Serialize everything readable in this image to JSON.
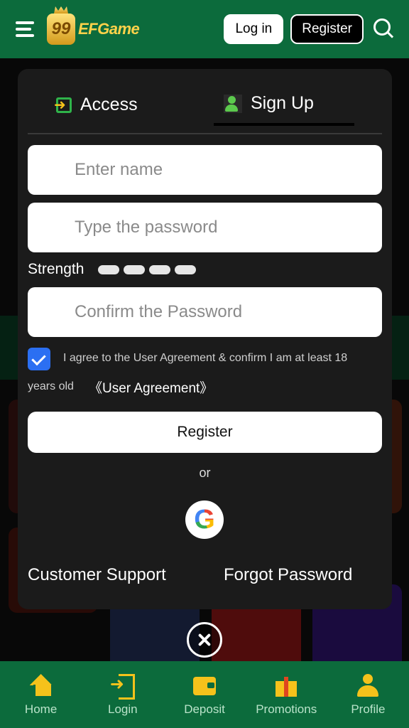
{
  "header": {
    "logo_mark": "99",
    "logo_text": "EFGame",
    "login_label": "Log in",
    "register_label": "Register"
  },
  "modal": {
    "tabs": [
      {
        "label": "Access",
        "icon": "access-icon"
      },
      {
        "label": "Sign Up",
        "icon": "add-user-icon",
        "active": true
      }
    ],
    "fields": {
      "name_placeholder": "Enter name",
      "password_placeholder": "Type the password",
      "confirm_placeholder": "Confirm the Password"
    },
    "strength_label": "Strength",
    "agreement": {
      "checked": true,
      "text_line1": "I agree to the User Agreement & confirm I am at least 18",
      "text_line2": "years old",
      "link": "《User Agreement》"
    },
    "register_button": "Register",
    "or_text": "or",
    "google_letter": "G",
    "customer_support": "Customer Support",
    "forgot_password": "Forgot Password"
  },
  "bottom_nav": [
    {
      "label": "Home",
      "icon": "home-icon"
    },
    {
      "label": "Login",
      "icon": "login-icon"
    },
    {
      "label": "Deposit",
      "icon": "wallet-icon"
    },
    {
      "label": "Promotions",
      "icon": "gift-icon"
    },
    {
      "label": "Profile",
      "icon": "profile-icon"
    }
  ],
  "colors": {
    "brand_green": "#0c6b3c",
    "accent_gold": "#f5c21b",
    "checkbox_blue": "#2b6ff2",
    "modal_bg": "#1b1b1b"
  }
}
